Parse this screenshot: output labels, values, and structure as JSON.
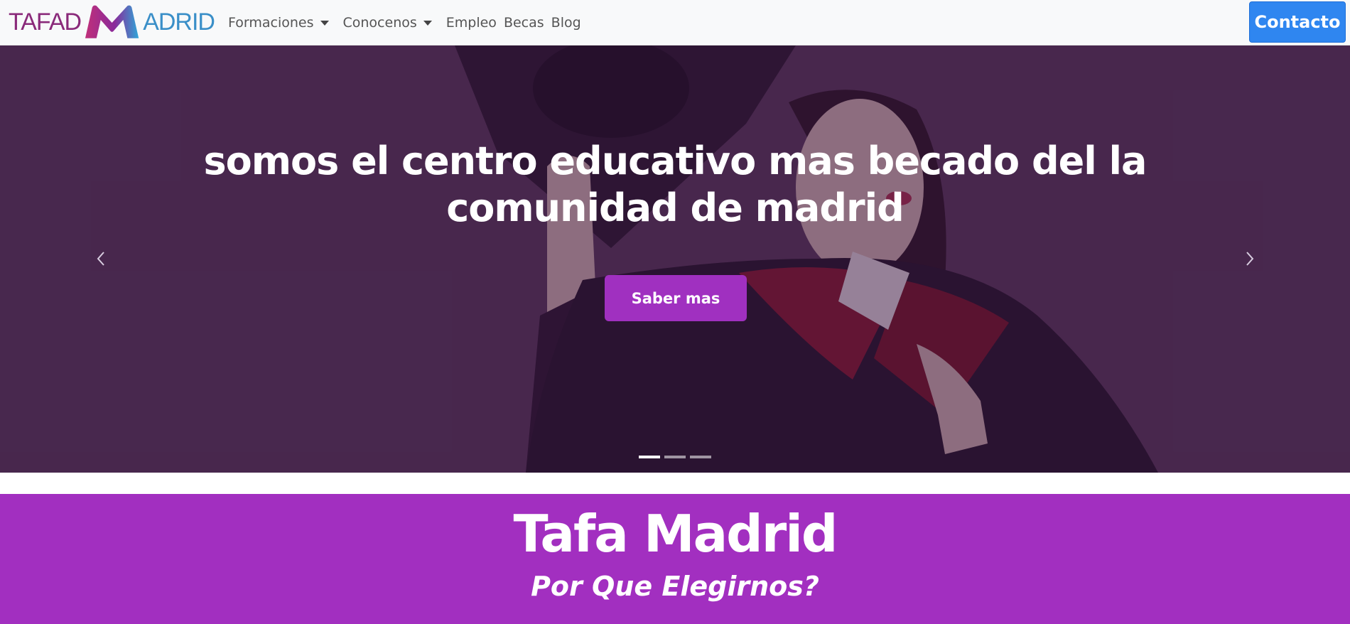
{
  "navbar": {
    "logo": {
      "left": "TAFAD",
      "right": "ADRID"
    },
    "links": [
      {
        "label": "Formaciones",
        "dropdown": true
      },
      {
        "label": "Conocenos",
        "dropdown": true
      },
      {
        "label": "Empleo",
        "dropdown": false
      },
      {
        "label": "Becas",
        "dropdown": false
      },
      {
        "label": "Blog",
        "dropdown": false
      }
    ],
    "contact_label": "Contacto"
  },
  "hero": {
    "title": "somos el centro educativo mas becado del la comunidad de madrid",
    "button_label": "Saber mas",
    "prev_icon": "chevron-left-icon",
    "next_icon": "chevron-right-icon",
    "slides_count": 3,
    "active_slide": 1
  },
  "about": {
    "title": "Tafa Madrid",
    "subtitle": "Por Que Elegirnos?"
  },
  "colors": {
    "navbar_bg": "#f8f9fa",
    "contact_btn": "#2f86f0",
    "brand_purple": "#a22fc0",
    "logo_purple": "#8a2a7a",
    "logo_blue": "#3a8fc8"
  }
}
